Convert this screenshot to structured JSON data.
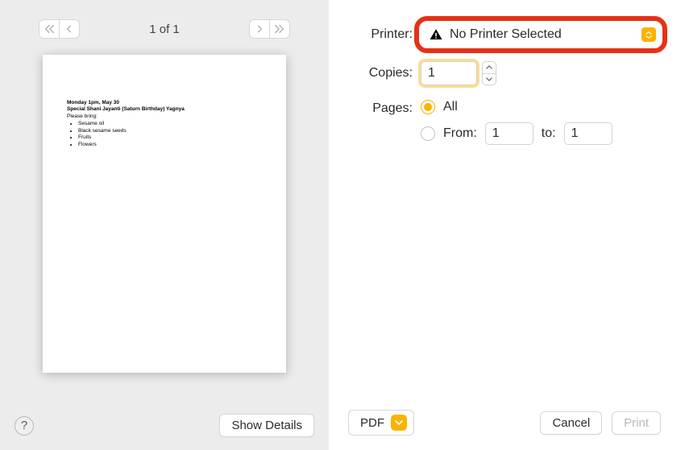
{
  "preview": {
    "page_counter": "1 of 1",
    "doc": {
      "line1": "Monday 1pm, May 30",
      "line2": "Special Shani Jayanti (Saturn Birthday) Yagnya",
      "line3": "Please bring:",
      "items": [
        "Sesame oil",
        "Black sesame seeds",
        "Fruits",
        "Flowers"
      ]
    }
  },
  "left_footer": {
    "help": "?",
    "show_details": "Show Details"
  },
  "form": {
    "printer_label": "Printer:",
    "printer_value": "No Printer Selected",
    "copies_label": "Copies:",
    "copies_value": "1",
    "pages_label": "Pages:",
    "pages_all": "All",
    "pages_from_label": "From:",
    "pages_from_value": "1",
    "pages_to_label": "to:",
    "pages_to_value": "1"
  },
  "right_footer": {
    "pdf": "PDF",
    "cancel": "Cancel",
    "print": "Print"
  }
}
